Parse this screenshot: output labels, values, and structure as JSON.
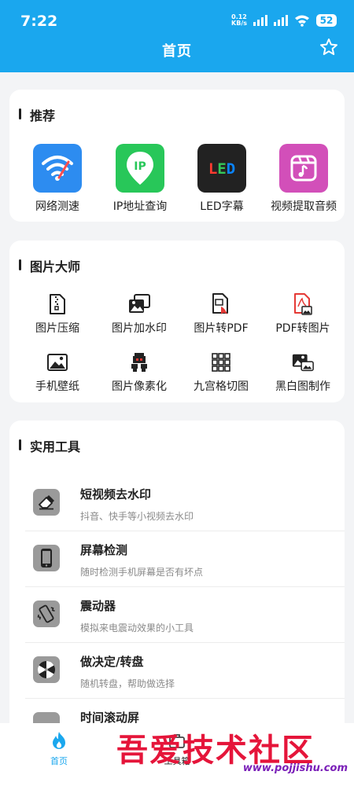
{
  "status_bar": {
    "time": "7:22",
    "net_speed_value": "0.12",
    "net_speed_unit": "KB/s",
    "battery": "52"
  },
  "header": {
    "title": "首页",
    "star_icon": "star-outline-icon"
  },
  "recommend": {
    "title": "推荐",
    "items": [
      {
        "label": "网络测速",
        "icon": "wifi-speed-icon",
        "color": "#2d8cf0"
      },
      {
        "label": "IP地址查询",
        "icon": "ip-location-icon",
        "color": "#28c759"
      },
      {
        "label": "LED字幕",
        "icon": "led-icon",
        "color": "#222222"
      },
      {
        "label": "视频提取音频",
        "icon": "video-audio-icon",
        "color": "#d24fb9"
      }
    ]
  },
  "image_master": {
    "title": "图片大师",
    "items": [
      {
        "label": "图片压缩",
        "icon": "zip-file-icon"
      },
      {
        "label": "图片加水印",
        "icon": "photos-stack-icon"
      },
      {
        "label": "图片转PDF",
        "icon": "image-to-pdf-icon"
      },
      {
        "label": "PDF转图片",
        "icon": "pdf-to-image-icon"
      },
      {
        "label": "手机壁纸",
        "icon": "wallpaper-icon"
      },
      {
        "label": "图片像素化",
        "icon": "pixel-character-icon"
      },
      {
        "label": "九宫格切图",
        "icon": "grid-nine-icon"
      },
      {
        "label": "黑白图制作",
        "icon": "black-white-image-icon"
      }
    ]
  },
  "tools": {
    "title": "实用工具",
    "items": [
      {
        "name": "短视频去水印",
        "desc": "抖音、快手等小视频去水印",
        "icon": "eraser-icon"
      },
      {
        "name": "屏幕检测",
        "desc": "随时检测手机屏幕是否有坏点",
        "icon": "phone-screen-icon"
      },
      {
        "name": "震动器",
        "desc": "模拟来电震动效果的小工具",
        "icon": "vibrate-phone-icon"
      },
      {
        "name": "做决定/转盘",
        "desc": "随机转盘，帮助做选择",
        "icon": "spin-wheel-icon"
      },
      {
        "name": "时间滚动屏",
        "desc": "",
        "icon": "scroll-screen-icon"
      }
    ]
  },
  "bottom_nav": {
    "tabs": [
      {
        "label": "首页",
        "icon": "flame-icon",
        "color": "#1aa7ee"
      },
      {
        "label": "工具箱",
        "icon": "toolbox-icon"
      }
    ]
  },
  "watermark": {
    "title": "吾爱技术社区",
    "url": "www.pojjishu.com"
  },
  "colors": {
    "primary": "#1aa7ee",
    "background": "#f3f4f6"
  }
}
